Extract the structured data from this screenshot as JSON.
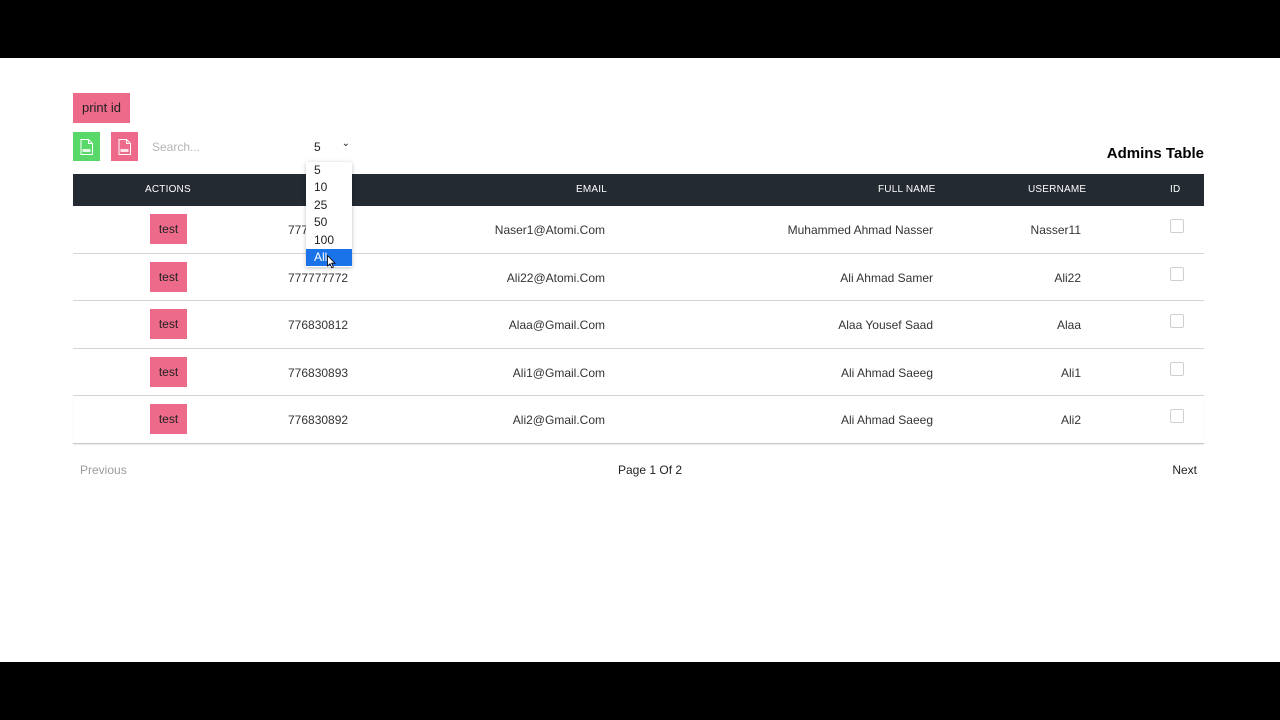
{
  "toolbar": {
    "print_label": "print id",
    "xls_icon": "xls-file-icon",
    "pdf_icon": "pdf-file-icon",
    "search_placeholder": "Search...",
    "page_size_value": "5"
  },
  "page_size_dropdown": {
    "options": [
      "5",
      "10",
      "25",
      "50",
      "100",
      "All"
    ],
    "highlighted": "All"
  },
  "table": {
    "title": "Admins Table",
    "headers": {
      "actions": "ACTIONS",
      "email": "EMAIL",
      "full_name": "FULL NAME",
      "username": "USERNAME",
      "id": "ID"
    },
    "rows": [
      {
        "action": "test",
        "phone": "777777771",
        "email": "Naser1@Atomi.Com",
        "full_name": "Muhammed Ahmad Nasser",
        "username": "Nasser11"
      },
      {
        "action": "test",
        "phone": "777777772",
        "email": "Ali22@Atomi.Com",
        "full_name": "Ali Ahmad Samer",
        "username": "Ali22"
      },
      {
        "action": "test",
        "phone": "776830812",
        "email": "Alaa@Gmail.Com",
        "full_name": "Alaa Yousef Saad",
        "username": "Alaa"
      },
      {
        "action": "test",
        "phone": "776830893",
        "email": "Ali1@Gmail.Com",
        "full_name": "Ali Ahmad Saeeg",
        "username": "Ali1"
      },
      {
        "action": "test",
        "phone": "776830892",
        "email": "Ali2@Gmail.Com",
        "full_name": "Ali Ahmad Saeeg",
        "username": "Ali2"
      }
    ]
  },
  "pagination": {
    "previous": "Previous",
    "page_info": "Page 1 Of 2",
    "next": "Next"
  },
  "colors": {
    "accent_pink": "#ee6a8a",
    "accent_green": "#58d868",
    "header_dark": "#232a31",
    "selected_blue": "#1a73e8"
  }
}
